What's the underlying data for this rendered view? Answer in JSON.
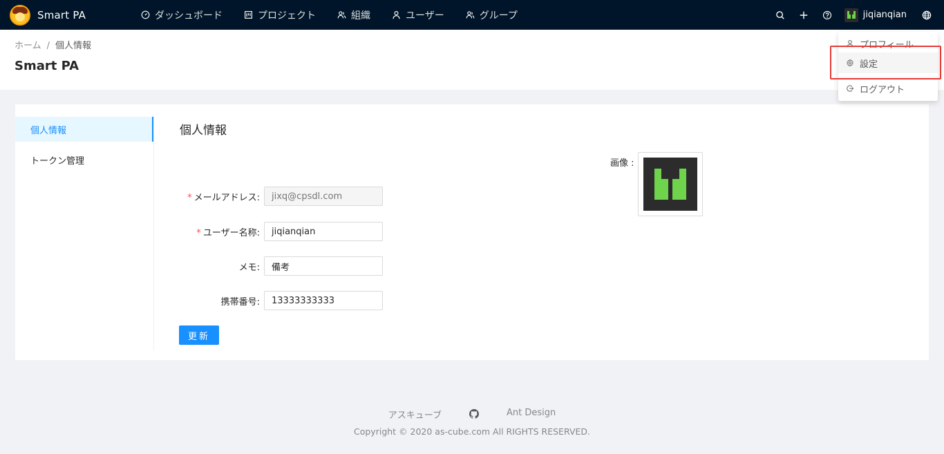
{
  "app": {
    "title": "Smart PA"
  },
  "nav": [
    {
      "label": "ダッシュボード",
      "icon": "dashboard-icon"
    },
    {
      "label": "プロジェクト",
      "icon": "project-icon"
    },
    {
      "label": "組織",
      "icon": "organization-icon"
    },
    {
      "label": "ユーザー",
      "icon": "user-icon"
    },
    {
      "label": "グループ",
      "icon": "group-icon"
    }
  ],
  "header": {
    "username": "jiqianqian"
  },
  "breadcrumb": {
    "home": "ホーム",
    "separator": "/",
    "current": "個人情報"
  },
  "page": {
    "title": "Smart PA"
  },
  "side_menu": [
    {
      "label": "個人情報",
      "active": true
    },
    {
      "label": "トークン管理",
      "active": false
    }
  ],
  "form": {
    "title": "個人情報",
    "email": {
      "label": "メールアドレス",
      "placeholder": "jixq@cpsdl.com",
      "value": ""
    },
    "username": {
      "label": "ユーザー名称",
      "value": "jiqianqian"
    },
    "memo": {
      "label": "メモ",
      "value": "備考"
    },
    "phone": {
      "label": "携帯番号",
      "value": "13333333333"
    },
    "colon": ":",
    "submit": "更新",
    "avatar_label": "画像 :"
  },
  "dropdown": {
    "items": [
      {
        "label": "プロフィール",
        "icon": "user-icon"
      },
      {
        "label": "設定",
        "icon": "gear-icon"
      },
      {
        "label": "ログアウト",
        "icon": "logout-icon"
      }
    ]
  },
  "footer": {
    "link1": "アスキューブ",
    "link2": "Ant Design",
    "copyright": "Copyright © 2020 as-cube.com All RIGHTS RESERVED."
  },
  "colors": {
    "header_bg": "#001529",
    "primary": "#1890ff",
    "highlight": "#e53935",
    "avatar_green": "#6fd34b"
  }
}
